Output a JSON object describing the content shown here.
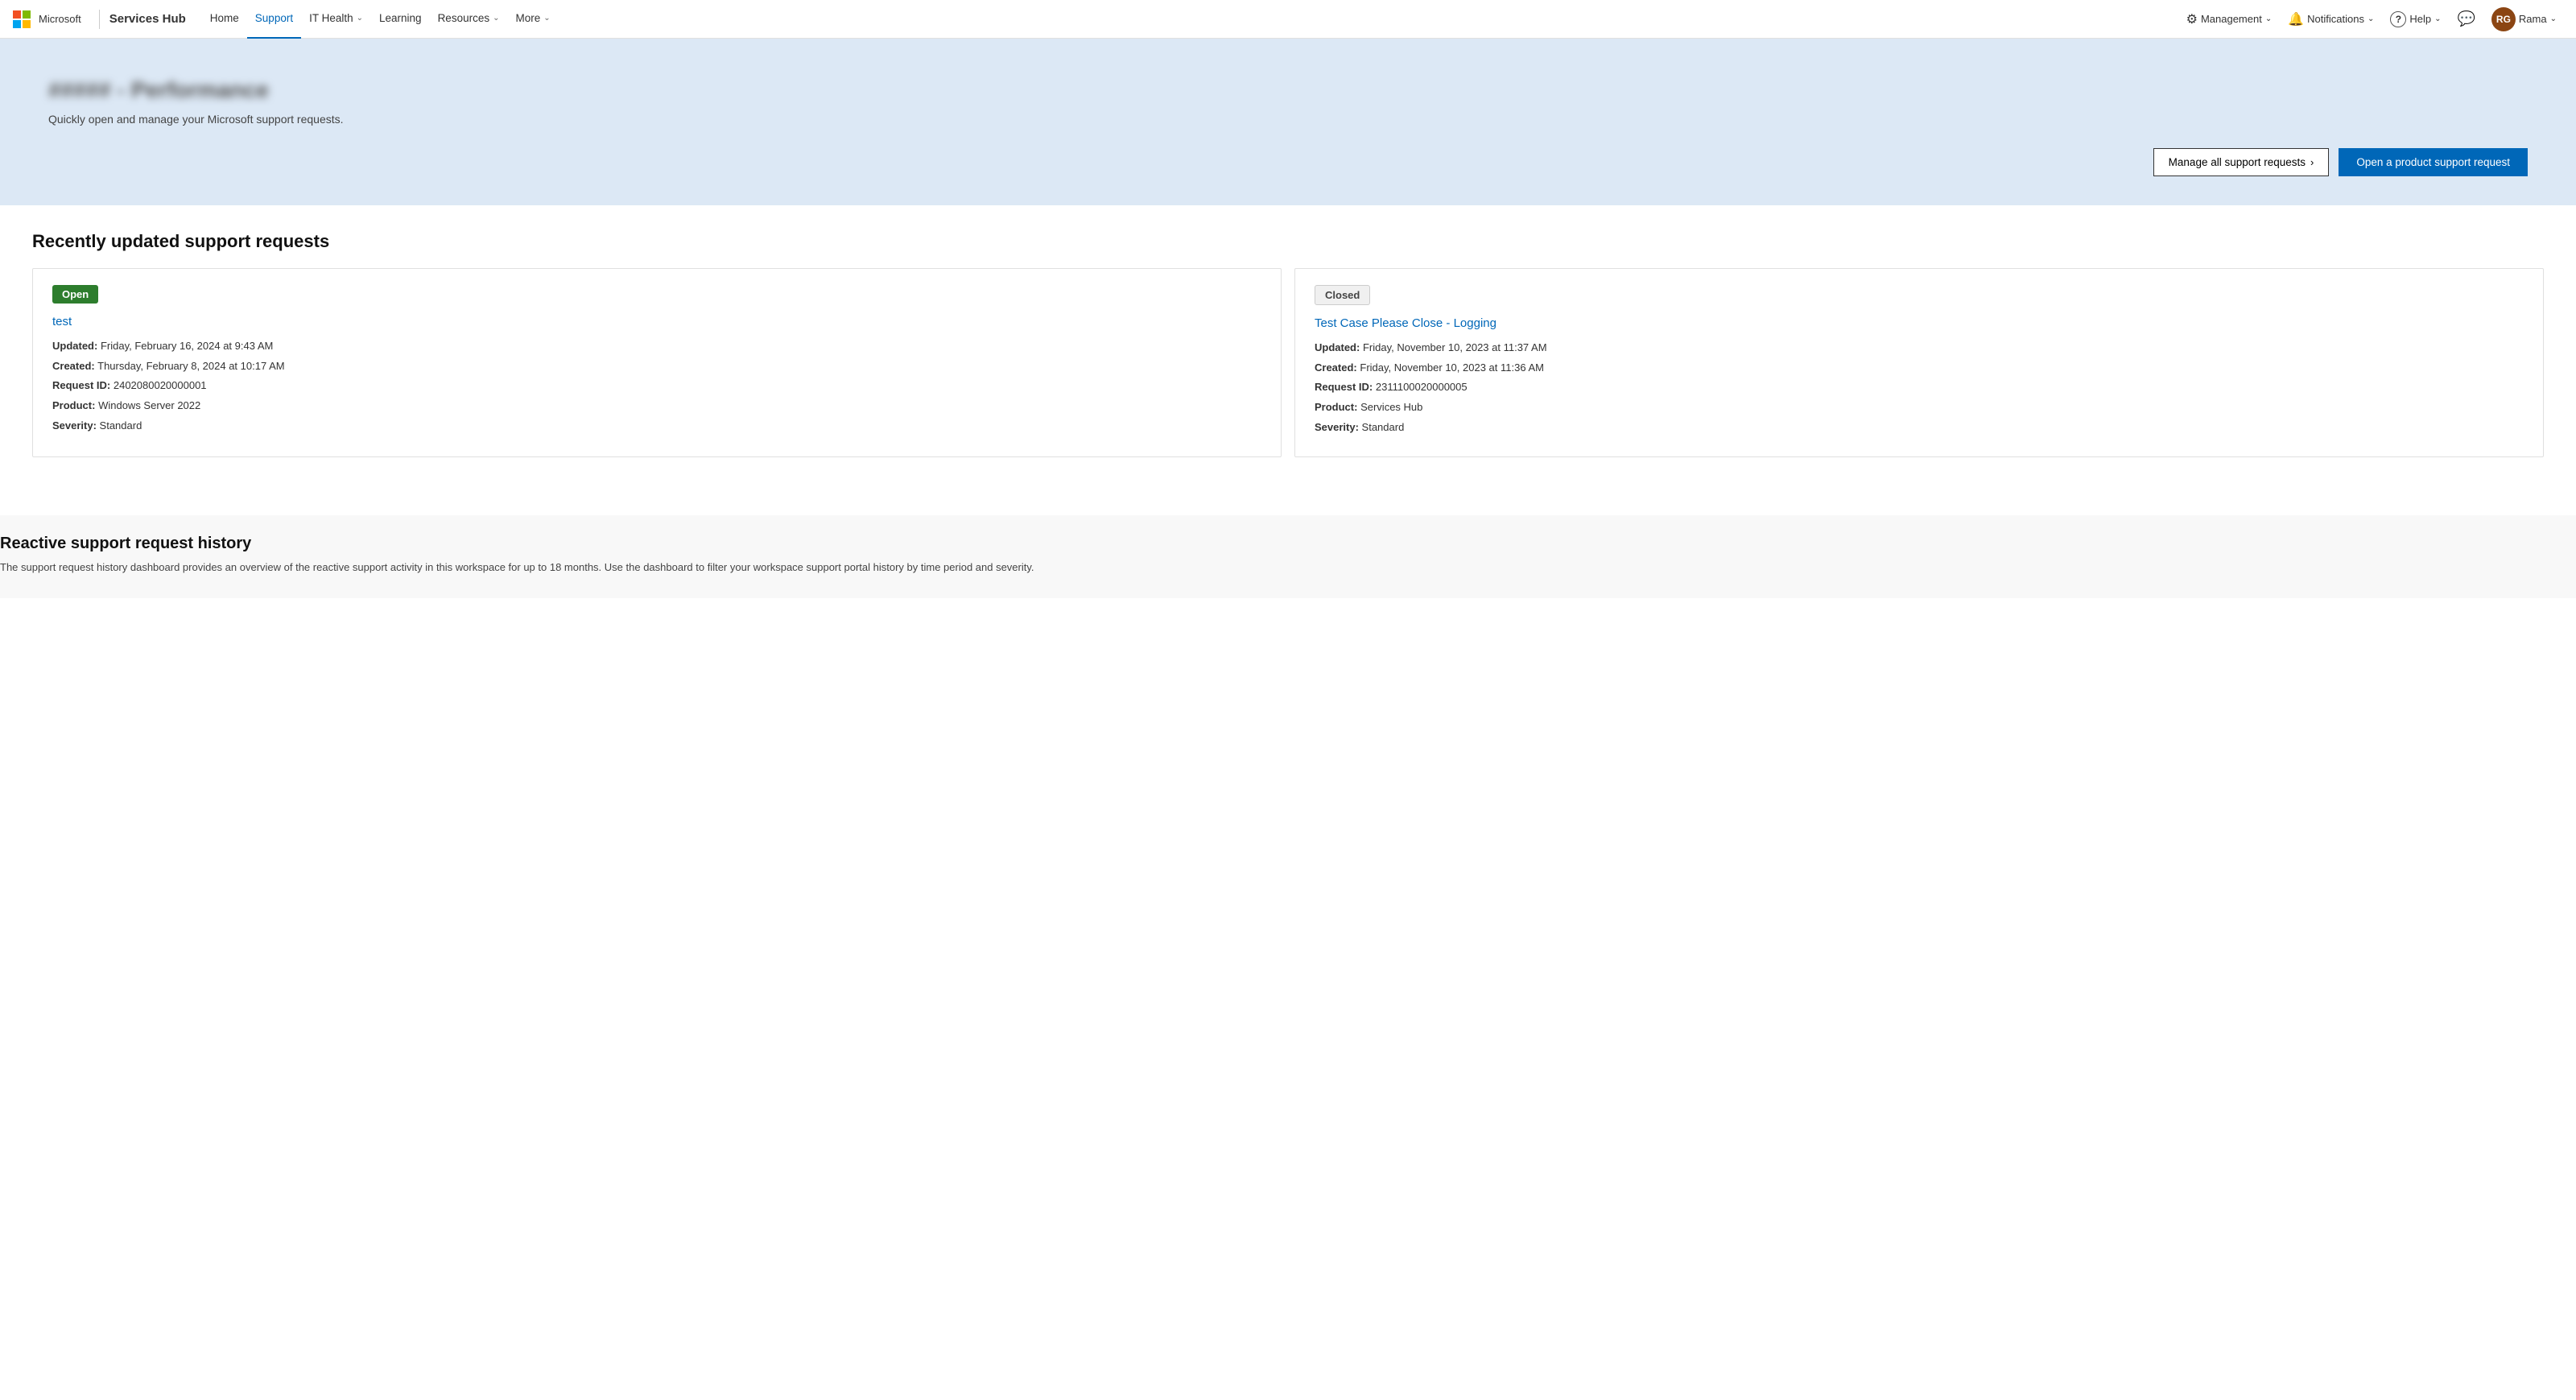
{
  "nav": {
    "brand": "Services Hub",
    "logo_title": "Microsoft",
    "links": [
      {
        "label": "Home",
        "active": false,
        "has_dropdown": false
      },
      {
        "label": "Support",
        "active": true,
        "has_dropdown": false
      },
      {
        "label": "IT Health",
        "active": false,
        "has_dropdown": true
      },
      {
        "label": "Learning",
        "active": false,
        "has_dropdown": false
      },
      {
        "label": "Resources",
        "active": false,
        "has_dropdown": true
      },
      {
        "label": "More",
        "active": false,
        "has_dropdown": true
      }
    ],
    "management": "Management",
    "notifications": "Notifications",
    "help": "Help",
    "user": {
      "initials": "RG",
      "name": "Rama"
    }
  },
  "hero": {
    "title": "##### - Performance",
    "subtitle": "Quickly open and manage your Microsoft support requests.",
    "btn_manage": "Manage all support requests",
    "btn_open": "Open a product support request"
  },
  "section": {
    "title": "Recently updated support requests"
  },
  "cards": [
    {
      "status": "Open",
      "status_type": "open",
      "title": "test",
      "updated": "Friday, February 16, 2024 at 9:43 AM",
      "created": "Thursday, February 8, 2024 at 10:17 AM",
      "request_id": "2402080020000001",
      "product": "Windows Server 2022",
      "severity": "Standard"
    },
    {
      "status": "Closed",
      "status_type": "closed",
      "title": "Test Case Please Close - Logging",
      "updated": "Friday, November 10, 2023 at 11:37 AM",
      "created": "Friday, November 10, 2023 at 11:36 AM",
      "request_id": "2311100020000005",
      "product": "Services Hub",
      "severity": "Standard"
    }
  ],
  "reactive": {
    "title": "Reactive support request history",
    "description": "The support request history dashboard provides an overview of the reactive support activity in this workspace for up to 18 months. Use the dashboard to filter your workspace support portal history by time period and severity."
  },
  "labels": {
    "updated": "Updated:",
    "created": "Created:",
    "request_id": "Request ID:",
    "product": "Product:",
    "severity": "Severity:"
  }
}
